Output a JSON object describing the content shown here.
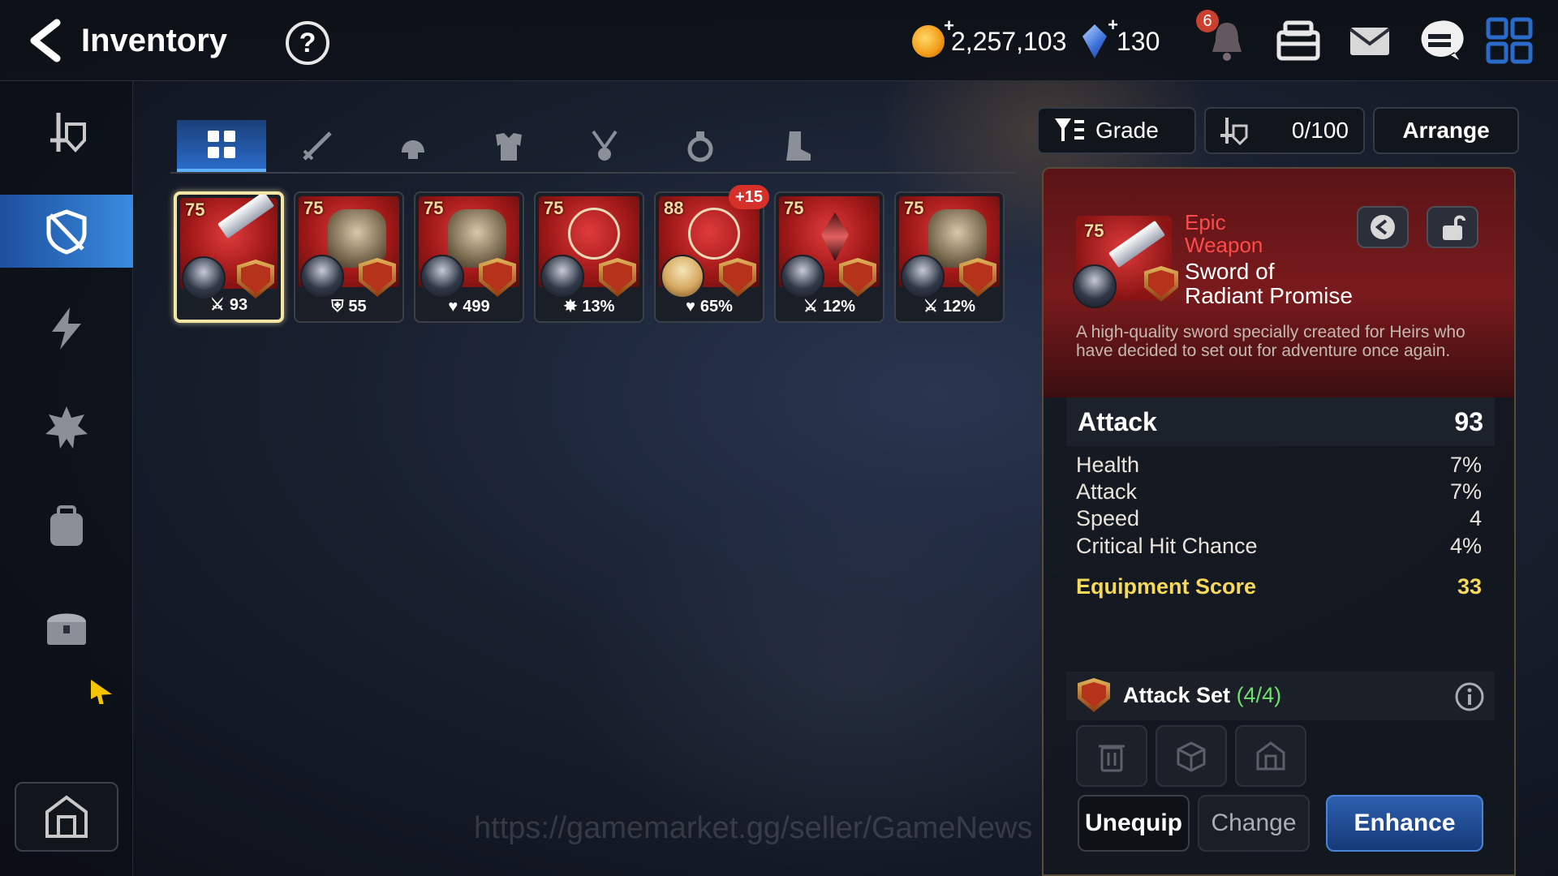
{
  "header": {
    "title": "Inventory",
    "help_label": "?",
    "gold": "2,257,103",
    "crystals": "130",
    "notification_count": "6"
  },
  "sidebar": {
    "items": [
      {
        "icon": "hero-sword-icon",
        "active": false
      },
      {
        "icon": "equipment-shield-icon",
        "active": true
      },
      {
        "icon": "lightning-icon",
        "active": false
      },
      {
        "icon": "artifact-icon",
        "active": false
      },
      {
        "icon": "bag-icon",
        "active": false
      },
      {
        "icon": "chest-icon",
        "active": false
      }
    ],
    "bottom_icon": "storage-icon"
  },
  "category_tabs": [
    "all-icon",
    "weapon-icon",
    "helmet-icon",
    "armor-icon",
    "necklace-icon",
    "ring-icon",
    "boots-icon"
  ],
  "items": [
    {
      "level": "75",
      "stat_icon": "attack-icon",
      "stat": "93",
      "type": "weapon"
    },
    {
      "level": "75",
      "stat_icon": "defense-icon",
      "stat": "55",
      "type": "helmet"
    },
    {
      "level": "75",
      "stat_icon": "health-icon",
      "stat": "499",
      "type": "armor"
    },
    {
      "level": "75",
      "stat_icon": "crit-icon",
      "stat": "13%",
      "type": "necklace"
    },
    {
      "level": "88",
      "stat_icon": "health-icon",
      "stat": "65%",
      "type": "necklace",
      "enhance": "+15"
    },
    {
      "level": "75",
      "stat_icon": "attack-icon",
      "stat": "12%",
      "type": "ring"
    },
    {
      "level": "75",
      "stat_icon": "attack-icon",
      "stat": "12%",
      "type": "boots"
    }
  ],
  "filters": {
    "grade_label": "Grade",
    "capacity": "0/100",
    "arrange_label": "Arrange"
  },
  "detail": {
    "level": "75",
    "grade": "Epic",
    "category": "Weapon",
    "name_line1": "Sword of",
    "name_line2": "Radiant Promise",
    "description": "A high-quality sword specially created for Heirs who have decided to set out for adventure once again.",
    "main_stat": {
      "label": "Attack",
      "value": "93"
    },
    "substats": [
      {
        "label": "Health",
        "value": "7%"
      },
      {
        "label": "Attack",
        "value": "7%"
      },
      {
        "label": "Speed",
        "value": "4"
      },
      {
        "label": "Critical Hit Chance",
        "value": "4%"
      }
    ],
    "score": {
      "label": "Equipment Score",
      "value": "33"
    },
    "set_name": "Attack Set",
    "set_count": "(4/4)",
    "buttons": {
      "unequip": "Unequip",
      "change": "Change",
      "enhance": "Enhance"
    }
  },
  "watermark": "https://gamemarket.gg/seller/GameNews",
  "colors": {
    "accent_blue": "#2a6ac8",
    "epic_red": "#ff4a4a",
    "score_yellow": "#f6d85a",
    "set_green": "#6ee06e"
  }
}
